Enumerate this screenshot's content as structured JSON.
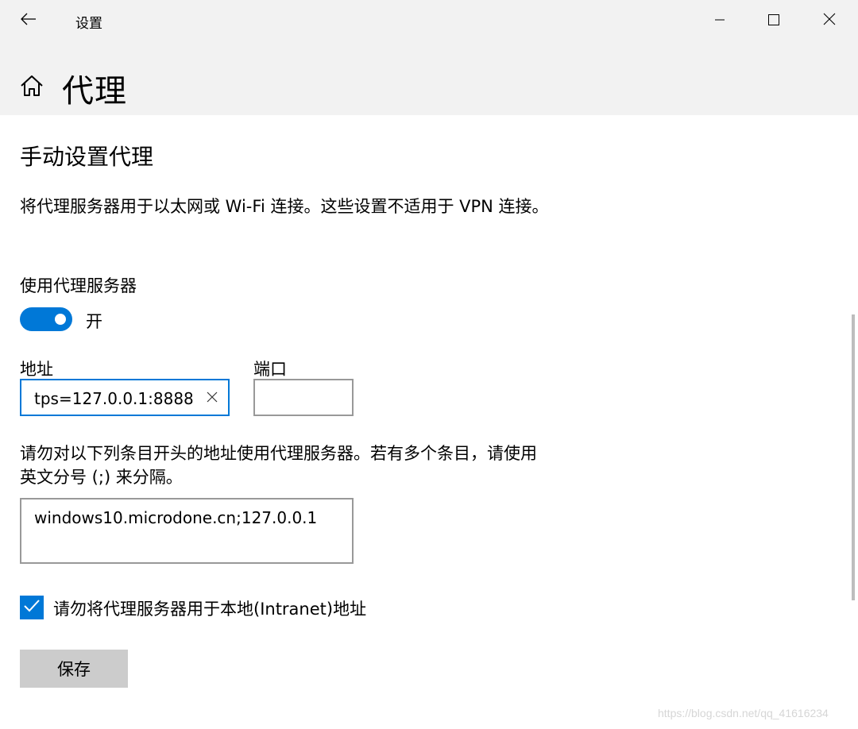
{
  "window": {
    "title": "设置",
    "controls": [
      "minimize",
      "maximize",
      "close"
    ]
  },
  "header": {
    "page_title": "代理"
  },
  "manual": {
    "section_title": "手动设置代理",
    "description": "将代理服务器用于以太网或 Wi-Fi 连接。这些设置不适用于 VPN 连接。",
    "toggle_label": "使用代理服务器",
    "toggle_state": "开",
    "toggle_on": true,
    "address_label": "地址",
    "address_value": "tps=127.0.0.1:8888",
    "port_label": "端口",
    "port_value": "",
    "exceptions_description": "请勿对以下列条目开头的地址使用代理服务器。若有多个条目，请使用英文分号 (;) 来分隔。",
    "exceptions_value": "windows10.microdone.cn;127.0.0.1",
    "bypass_local_label": "请勿将代理服务器用于本地(Intranet)地址",
    "bypass_local_checked": true,
    "save_label": "保存"
  },
  "watermark": "https://blog.csdn.net/qq_41616234",
  "colors": {
    "accent": "#0078d7",
    "header_bg": "#f2f2f2",
    "input_border": "#999999",
    "button_bg": "#cccccc"
  },
  "icons": {
    "back": "back-arrow-icon",
    "home": "home-icon",
    "minimize": "minimize-icon",
    "maximize": "maximize-icon",
    "close": "close-icon",
    "clear": "clear-icon",
    "check": "checkmark-icon"
  }
}
